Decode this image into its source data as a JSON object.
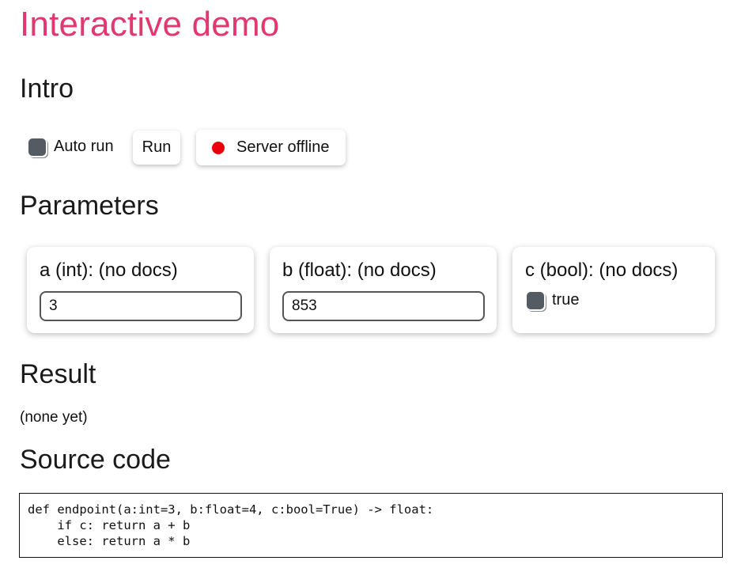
{
  "page": {
    "title": "Interactive demo",
    "accent_color": "#e0396f"
  },
  "intro": {
    "heading": "Intro",
    "auto_run_label": "Auto run",
    "auto_run_checked": true,
    "run_button": "Run",
    "server_status": "Server offline",
    "server_status_color": "#e8000a"
  },
  "parameters": {
    "heading": "Parameters",
    "items": [
      {
        "label": "a (int): (no docs)",
        "value": "3"
      },
      {
        "label": "b (float): (no docs)",
        "value": "853"
      },
      {
        "label": "c (bool): (no docs)",
        "checkbox_label": "true",
        "checked": true
      }
    ]
  },
  "result": {
    "heading": "Result",
    "value": "(none yet)"
  },
  "source": {
    "heading": "Source code",
    "code": "def endpoint(a:int=3, b:float=4, c:bool=True) -> float:\n    if c: return a + b\n    else: return a * b"
  }
}
